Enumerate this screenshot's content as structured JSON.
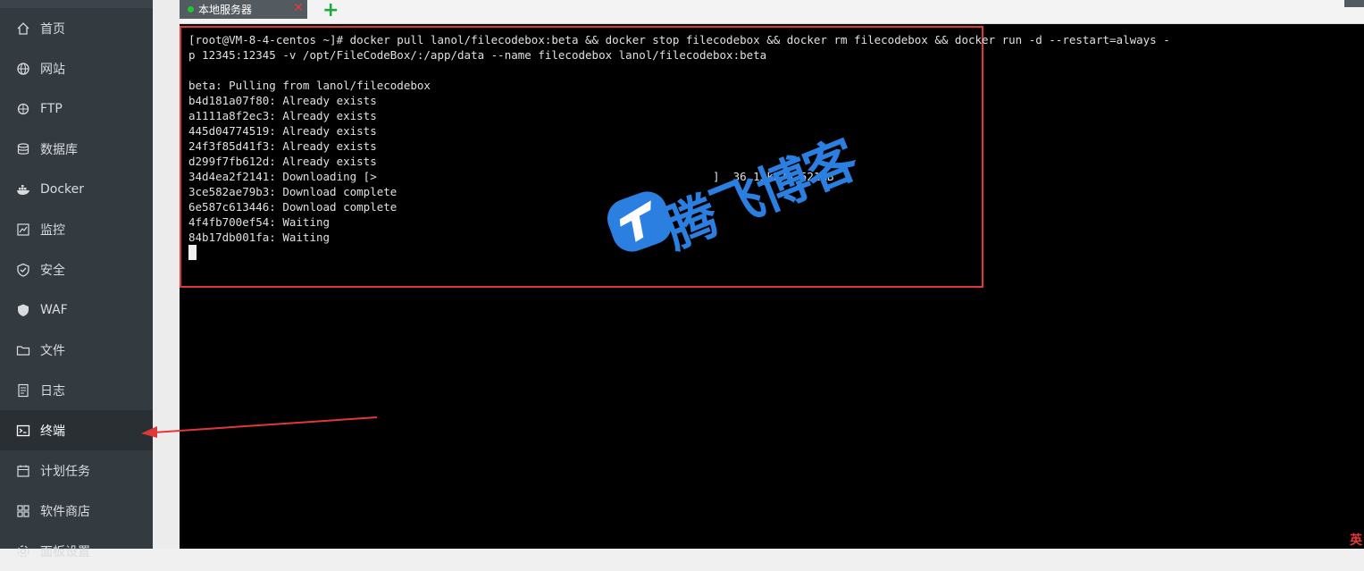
{
  "sidebar": {
    "items": [
      {
        "label": "首页",
        "icon": "home-icon"
      },
      {
        "label": "网站",
        "icon": "globe-icon"
      },
      {
        "label": "FTP",
        "icon": "ftp-icon"
      },
      {
        "label": "数据库",
        "icon": "database-icon"
      },
      {
        "label": "Docker",
        "icon": "docker-icon"
      },
      {
        "label": "监控",
        "icon": "monitor-icon"
      },
      {
        "label": "安全",
        "icon": "shield-icon"
      },
      {
        "label": "WAF",
        "icon": "waf-shield-icon"
      },
      {
        "label": "文件",
        "icon": "folder-icon"
      },
      {
        "label": "日志",
        "icon": "log-icon"
      },
      {
        "label": "终端",
        "icon": "terminal-icon",
        "active": true
      },
      {
        "label": "计划任务",
        "icon": "calendar-icon"
      },
      {
        "label": "软件商店",
        "icon": "apps-grid-icon"
      },
      {
        "label": "面板设置",
        "icon": "settings-icon"
      }
    ]
  },
  "tabs": [
    {
      "label": "本地服务器",
      "status_color": "#20c43a"
    }
  ],
  "add_tab_symbol": "+",
  "terminal": {
    "lines": [
      "[root@VM-8-4-centos ~]# docker pull lanol/filecodebox:beta && docker stop filecodebox && docker rm filecodebox && docker run -d --restart=always -",
      "p 12345:12345 -v /opt/FileCodeBox/:/app/data --name filecodebox lanol/filecodebox:beta",
      "",
      "beta: Pulling from lanol/filecodebox",
      "b4d181a07f80: Already exists",
      "a1111a8f2ec3: Already exists",
      "445d04774519: Already exists",
      "24f3f85d41f3: Already exists",
      "d299f7fb612d: Already exists",
      "34d4ea2f2141: Downloading [>                                                  ]  36.13kB/3.521MB",
      "3ce582ae79b3: Download complete",
      "6e587c613446: Download complete",
      "4f4fb700ef54: Waiting",
      "84b17db001fa: Waiting"
    ]
  },
  "watermark": {
    "text": "腾飞博客"
  },
  "corner_text": "英",
  "colors": {
    "sidebar_bg": "#333a40",
    "terminal_bg": "#000000",
    "annotation_red": "#e0383a",
    "accent_blue": "#2a7fe0"
  }
}
